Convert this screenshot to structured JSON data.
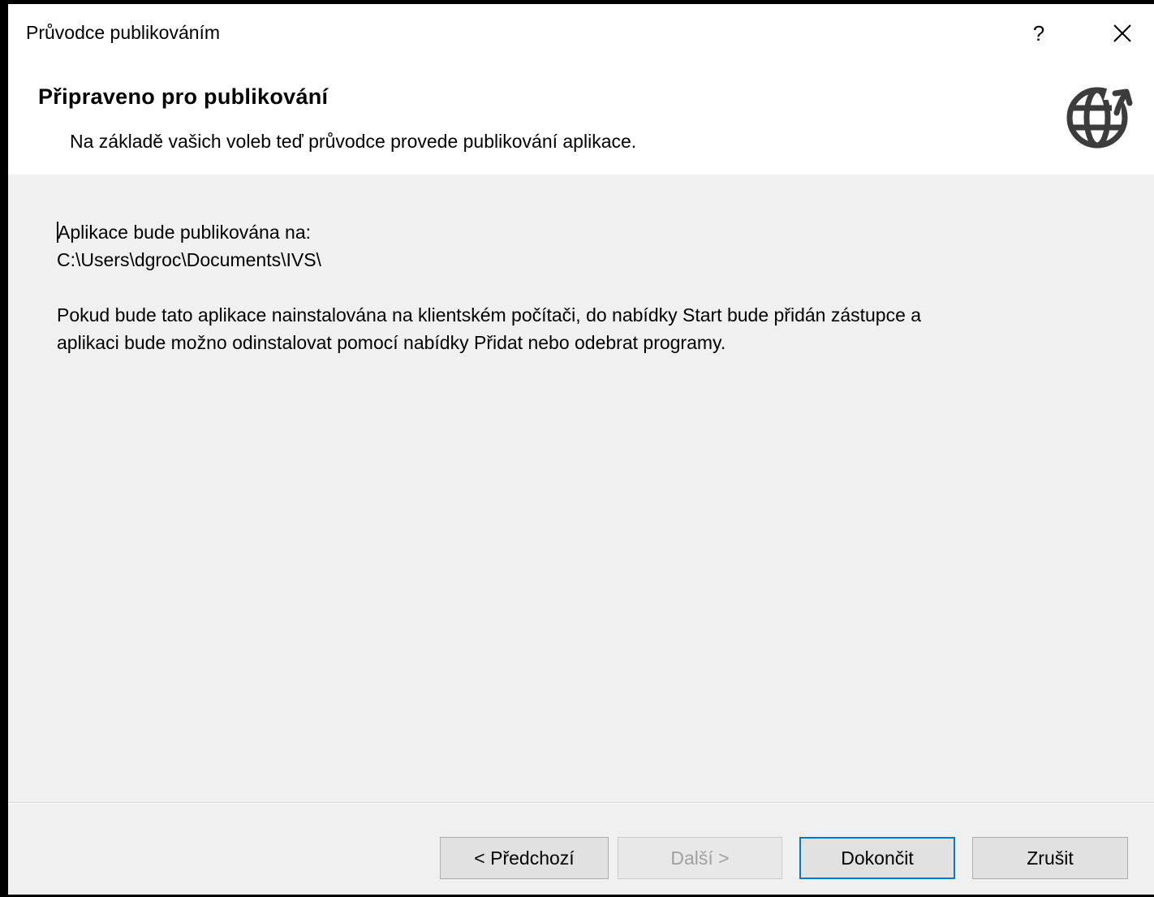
{
  "window": {
    "title": "Průvodce publikováním",
    "help_label": "?"
  },
  "header": {
    "title": "Připraveno pro publikování",
    "subtitle": "Na základě vašich voleb teď průvodce provede publikování aplikace.",
    "icon": "globe-upload-icon"
  },
  "content": {
    "publish_label": "Aplikace bude publikována na:",
    "publish_path": "C:\\Users\\dgroc\\Documents\\IVS\\",
    "install_info_line1": "Pokud bude tato aplikace nainstalována na klientském počítači, do nabídky Start bude přidán zástupce a",
    "install_info_line2": "aplikaci bude možno odinstalovat pomocí nabídky Přidat nebo odebrat programy."
  },
  "buttons": {
    "previous": "< Předchozí",
    "next": "Další >",
    "finish": "Dokončit",
    "cancel": "Zrušit"
  },
  "colors": {
    "accent": "#0078d7",
    "dialog_background": "#f0f0f0",
    "header_background": "#ffffff",
    "icon_color": "#3c3c3c"
  }
}
